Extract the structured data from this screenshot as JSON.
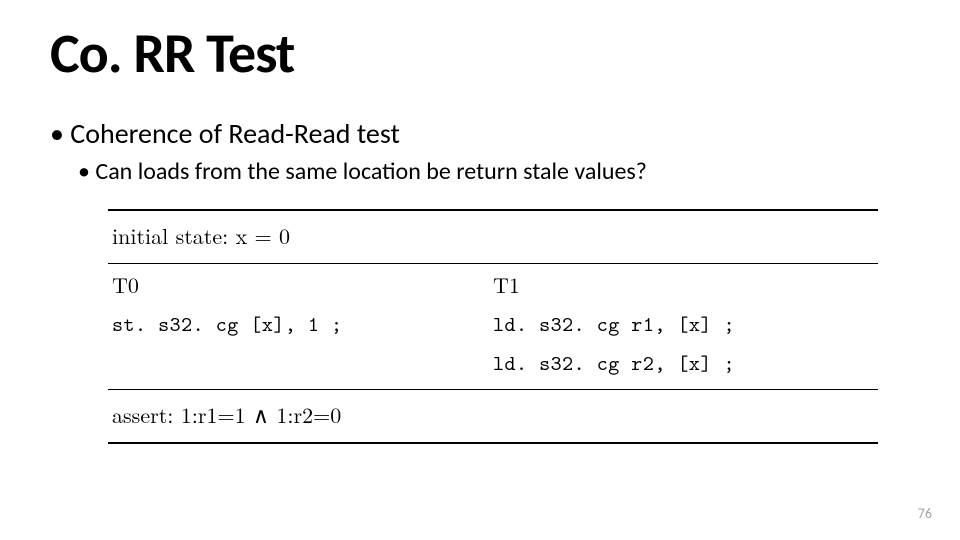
{
  "title": "Co. RR Test",
  "bullets": {
    "lvl1": "Coherence of Read-Read test",
    "lvl2": "Can loads from the same location be return stale values?"
  },
  "table": {
    "initial": "initial state: x = 0",
    "t0_label": "T0",
    "t1_label": "T1",
    "t0_line1": "st. s32. cg [x], 1 ;",
    "t1_line1": "ld. s32. cg r1, [x] ;",
    "t1_line2": "ld. s32. cg r2, [x] ;",
    "assert": "assert: 1:r1=1 ∧ 1:r2=0"
  },
  "page_number": "76"
}
